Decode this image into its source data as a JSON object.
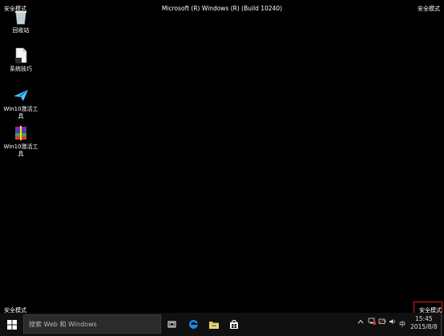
{
  "safe_mode_label": "安全模式",
  "window_title": "Microsoft (R) Windows (R) (Build 10240)",
  "desktop": {
    "icons": [
      {
        "label": "回收站",
        "icon": "recycle-bin-icon"
      },
      {
        "label": "系统技巧",
        "icon": "document-icon"
      },
      {
        "label": "Win10激活工具",
        "icon": "paper-plane-icon"
      },
      {
        "label": "Win10激活工具",
        "icon": "winrar-archive-icon"
      }
    ]
  },
  "taskbar": {
    "search_placeholder": "搜索 Web 和 Windows",
    "apps": [
      "task-view-icon",
      "edge-browser-icon",
      "file-explorer-icon",
      "store-icon"
    ],
    "tray": {
      "ime": "中",
      "time": "15:45",
      "date": "2015/8/8"
    }
  },
  "colors": {
    "background": "#000000",
    "taskbar": "#101010",
    "highlight": "#e02020",
    "edge_blue": "#1e88e5",
    "folder_yellow": "#f0c040"
  }
}
